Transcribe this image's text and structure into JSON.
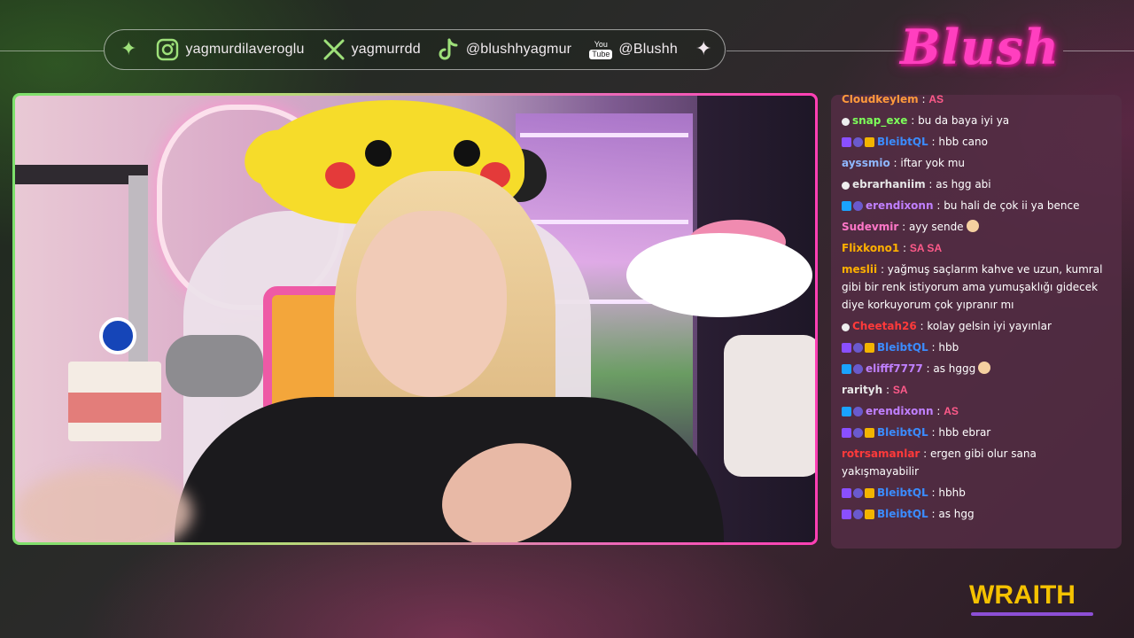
{
  "social": [
    {
      "icon": "instagram-icon",
      "handle": "yagmurdilaveroglu"
    },
    {
      "icon": "x-icon",
      "handle": "yagmurrdd"
    },
    {
      "icon": "tiktok-icon",
      "handle": "@blushhyagmur"
    },
    {
      "icon": "youtube-icon",
      "handle": "@Blushh",
      "icon_top": "You",
      "icon_bottom": "Tube"
    }
  ],
  "brand": {
    "logo_text": "Blush",
    "accent": "#ff3fbf"
  },
  "sponsor": {
    "text": "WRAITH",
    "color": "#f5c200"
  },
  "chat": {
    "messages": [
      {
        "user": "Cloudkeylem",
        "color": "#ff9a3c",
        "badges": [],
        "text": "AS",
        "emote": true,
        "cut": true
      },
      {
        "user": "snap_exe",
        "color": "#7dff5a",
        "badges": [
          "gift"
        ],
        "text": "bu da baya iyi ya"
      },
      {
        "user": "BleibtQL",
        "color": "#3b8cff",
        "badges": [
          "purple",
          "sub",
          "gold"
        ],
        "text": "hbb cano"
      },
      {
        "user": "ayssmio",
        "color": "#8fb8ff",
        "badges": [],
        "text": "iftar yok mu"
      },
      {
        "user": "ebrarhaniim",
        "color": "#e6e6e6",
        "badges": [
          "gift"
        ],
        "text": "as hgg abi"
      },
      {
        "user": "erendixonn",
        "color": "#c080ff",
        "badges": [
          "blue",
          "sub"
        ],
        "text": "bu hali de çok ii ya bence"
      },
      {
        "user": "Sudevmir",
        "color": "#ff77c8",
        "badges": [],
        "text": "ayy sende",
        "face": true
      },
      {
        "user": "Flixkono1",
        "color": "#ffb000",
        "badges": [],
        "text": "SA SA",
        "emote": true
      },
      {
        "user": "meslii",
        "color": "#ffb000",
        "badges": [],
        "text": "yağmuş saçlarım kahve ve uzun, kumral gibi bir renk istiyorum ama yumuşaklığı gidecek diye korkuyorum çok yıpranır mı"
      },
      {
        "user": "Cheetah26",
        "color": "#ff3a3a",
        "badges": [
          "gift"
        ],
        "text": "kolay gelsin iyi yayınlar"
      },
      {
        "user": "BleibtQL",
        "color": "#3b8cff",
        "badges": [
          "purple",
          "sub",
          "gold"
        ],
        "text": "hbb"
      },
      {
        "user": "elifff7777",
        "color": "#c080ff",
        "badges": [
          "blue",
          "sub"
        ],
        "text": "as hggg",
        "face": true
      },
      {
        "user": "rarityh",
        "color": "#e6e6e6",
        "badges": [],
        "text": "SA",
        "emote": true
      },
      {
        "user": "erendixonn",
        "color": "#c080ff",
        "badges": [
          "blue",
          "sub"
        ],
        "text": "AS",
        "emote": true
      },
      {
        "user": "BleibtQL",
        "color": "#3b8cff",
        "badges": [
          "purple",
          "sub",
          "gold"
        ],
        "text": "hbb ebrar"
      },
      {
        "user": "rotrsamanlar",
        "color": "#ff3a3a",
        "badges": [],
        "text": "ergen gibi olur sana yakışmayabilir"
      },
      {
        "user": "BleibtQL",
        "color": "#3b8cff",
        "badges": [
          "purple",
          "sub",
          "gold"
        ],
        "text": "hbhb"
      },
      {
        "user": "BleibtQL",
        "color": "#3b8cff",
        "badges": [
          "purple",
          "sub",
          "gold"
        ],
        "text": "as hgg"
      }
    ]
  }
}
